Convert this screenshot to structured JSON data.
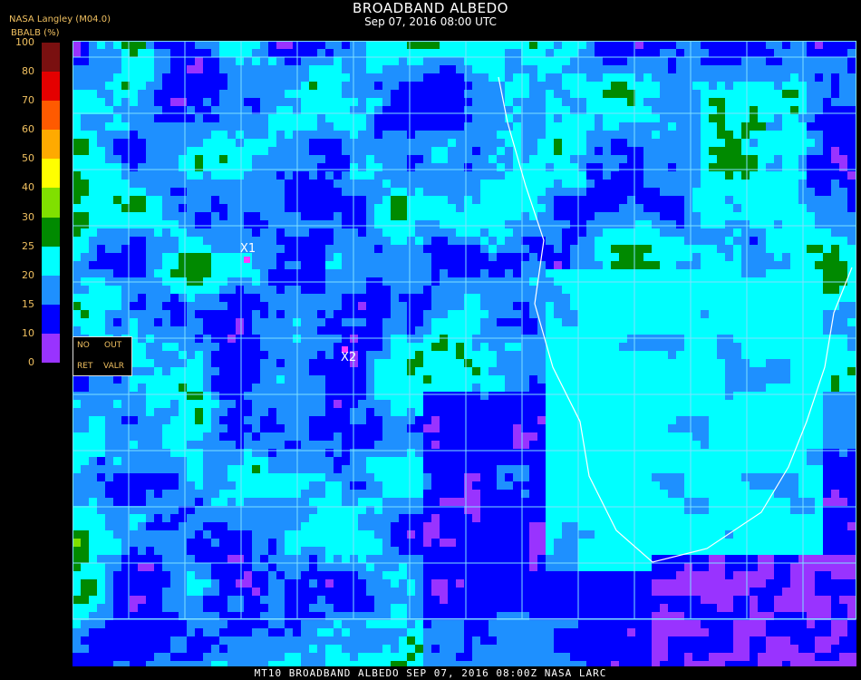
{
  "header": {
    "title": "BROADBAND ALBEDO",
    "subtitle": "Sep 07, 2016 08:00 UTC",
    "source": "NASA Langley (M04.0)",
    "unit_label": "BBALB (%)"
  },
  "colorbar": {
    "ticks": [
      "100",
      "80",
      "70",
      "60",
      "50",
      "40",
      "30",
      "25",
      "20",
      "15",
      "10",
      "0"
    ],
    "segments": [
      {
        "from": 80,
        "to": 100,
        "color": "#7a1010"
      },
      {
        "from": 70,
        "to": 80,
        "color": "#e40000"
      },
      {
        "from": 60,
        "to": 70,
        "color": "#ff5a00"
      },
      {
        "from": 50,
        "to": 60,
        "color": "#ffaa00"
      },
      {
        "from": 40,
        "to": 50,
        "color": "#ffff00"
      },
      {
        "from": 30,
        "to": 40,
        "color": "#80e000"
      },
      {
        "from": 25,
        "to": 30,
        "color": "#008a00"
      },
      {
        "from": 20,
        "to": 25,
        "color": "#00ffff"
      },
      {
        "from": 15,
        "to": 20,
        "color": "#1e90ff"
      },
      {
        "from": 10,
        "to": 15,
        "color": "#0000ff"
      },
      {
        "from": 0,
        "to": 10,
        "color": "#9933ff"
      }
    ]
  },
  "legend_box": {
    "no_ret": [
      "NO",
      "RET"
    ],
    "out_valr": [
      "OUT",
      "VALR"
    ]
  },
  "markers": {
    "x1": "X1",
    "x2": "X2"
  },
  "footer": "MT10  BROADBAND ALBEDO  SEP 07, 2016 08:00Z  NASA LARC",
  "colors": {
    "grid": "#7fe0ff",
    "coast": "#ffffff",
    "accent": "#f0c060"
  }
}
